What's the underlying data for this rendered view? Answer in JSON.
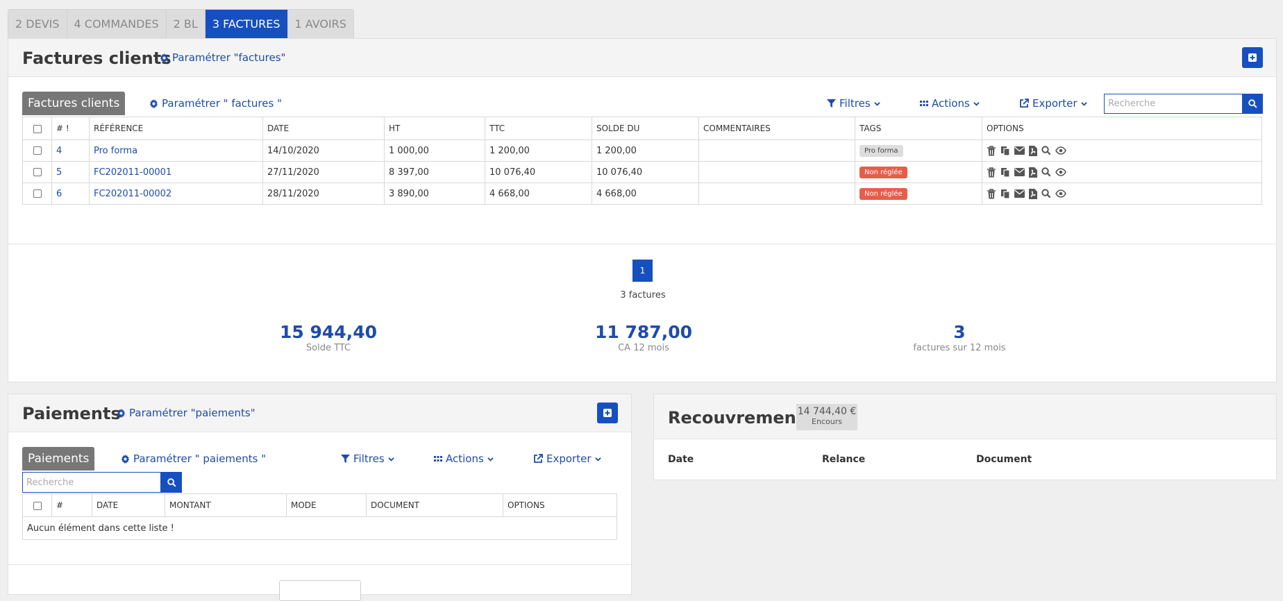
{
  "tabs": [
    "2 DEVIS",
    "4 COMMANDES",
    "2 BL",
    "3 FACTURES",
    "1 AVOIRS"
  ],
  "factures": {
    "title": "Factures clients",
    "param_link": "Paramétrer \"factures\"",
    "list_tab": "Factures clients",
    "list_param": "Paramétrer \" factures \"",
    "toolbar": {
      "filtres": "Filtres",
      "actions": "Actions",
      "exporter": "Exporter"
    },
    "search_placeholder": "Recherche",
    "columns": [
      "# !",
      "RÉFÉRENCE",
      "DATE",
      "HT",
      "TTC",
      "SOLDE DU",
      "COMMENTAIRES",
      "TAGS",
      "OPTIONS"
    ],
    "rows": [
      {
        "num": "4",
        "ref": "Pro forma",
        "date": "14/10/2020",
        "ht": "1 000,00",
        "ttc": "1 200,00",
        "solde": "1 200,00",
        "comment": "",
        "tag": "Pro forma",
        "tag_style": "grey"
      },
      {
        "num": "5",
        "ref": "FC202011-00001",
        "date": "27/11/2020",
        "ht": "8 397,00",
        "ttc": "10 076,40",
        "solde": "10 076,40",
        "comment": "",
        "tag": "Non réglée",
        "tag_style": "red"
      },
      {
        "num": "6",
        "ref": "FC202011-00002",
        "date": "28/11/2020",
        "ht": "3 890,00",
        "ttc": "4 668,00",
        "solde": "4 668,00",
        "comment": "",
        "tag": "Non réglée",
        "tag_style": "red"
      }
    ],
    "pagination": {
      "current": "1",
      "count_label": "3 factures"
    },
    "stats": [
      {
        "value": "15 944,40",
        "label": "Solde TTC"
      },
      {
        "value": "11 787,00",
        "label": "CA 12 mois"
      },
      {
        "value": "3",
        "label": "factures sur 12 mois"
      }
    ]
  },
  "paiements": {
    "title": "Paiements",
    "param_link": "Paramétrer \"paiements\"",
    "list_tab": "Paiements",
    "list_param": "Paramétrer \" paiements \"",
    "toolbar": {
      "filtres": "Filtres",
      "actions": "Actions",
      "exporter": "Exporter"
    },
    "search_placeholder": "Recherche",
    "columns": [
      "#",
      "DATE",
      "MONTANT",
      "MODE",
      "DOCUMENT",
      "OPTIONS"
    ],
    "empty": "Aucun élément dans cette liste !"
  },
  "recouvrement": {
    "title": "Recouvrement",
    "badge_value": "14 744,40 €",
    "badge_label": "Encours",
    "columns": [
      "Date",
      "Relance",
      "Document"
    ]
  },
  "colors": {
    "primary": "#1650c0",
    "link": "#1e4bab",
    "tag_red": "#e85d4a",
    "tab_grey": "#777777"
  }
}
